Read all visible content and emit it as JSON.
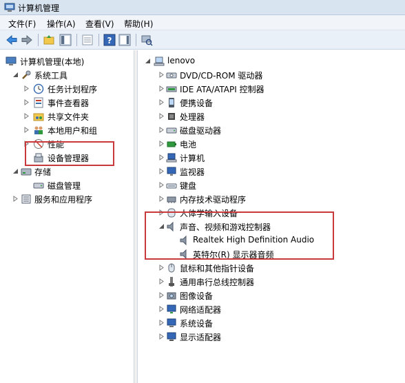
{
  "window": {
    "title": "计算机管理"
  },
  "menu": [
    "文件(F)",
    "操作(A)",
    "查看(V)",
    "帮助(H)"
  ],
  "left_tree": {
    "root": "计算机管理(本地)",
    "system_tools": "系统工具",
    "task_scheduler": "任务计划程序",
    "event_viewer": "事件查看器",
    "shared_folders": "共享文件夹",
    "local_users": "本地用户和组",
    "performance": "性能",
    "device_manager": "设备管理器",
    "storage": "存储",
    "disk_management": "磁盘管理",
    "services_apps": "服务和应用程序"
  },
  "right_tree": {
    "root": "lenovo",
    "categories": [
      "DVD/CD-ROM 驱动器",
      "IDE ATA/ATAPI 控制器",
      "便携设备",
      "处理器",
      "磁盘驱动器",
      "电池",
      "计算机",
      "监视器",
      "键盘",
      "内存技术驱动程序",
      "人体学输入设备"
    ],
    "sound_category": "声音、视频和游戏控制器",
    "sound_children": [
      "Realtek High Definition Audio",
      "英特尔(R) 显示器音频"
    ],
    "categories_after": [
      "鼠标和其他指针设备",
      "通用串行总线控制器",
      "图像设备",
      "网络适配器",
      "系统设备",
      "显示适配器"
    ]
  },
  "colors": {
    "highlight_box": "#c9383a",
    "selection": "#dce8f6"
  }
}
